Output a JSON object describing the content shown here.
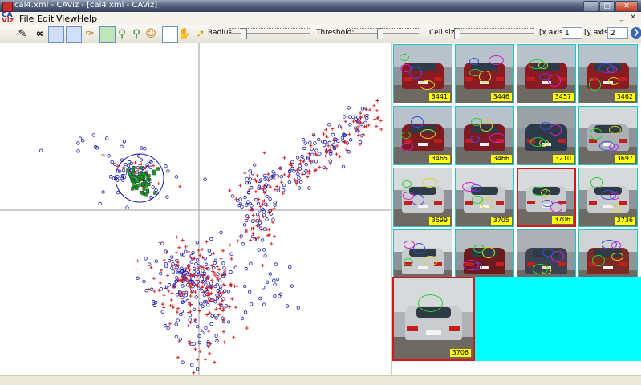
{
  "window": {
    "title": "cal4.xml - CAViz - [cal4.xml - CAViz]",
    "controls": [
      "minimize",
      "maximize",
      "close"
    ]
  },
  "menu": {
    "logo_top": "CA",
    "logo_bottom": "Viz",
    "items": [
      "File",
      "Edit",
      "View",
      "Help"
    ]
  },
  "toolbar": {
    "radius_label": "Radius:",
    "radius_level": 0.15,
    "threshold_label": "Threshold:",
    "threshold_level": 0.45,
    "cellsize_label": "Cell size:",
    "cellsize_level": 0.0,
    "xaxis_label": "[x axis]:",
    "xaxis_value": "1",
    "yaxis_label": "[y axis]:",
    "yaxis_value": "2",
    "icons": [
      "edit-icon",
      "glasses-icon",
      "select-w-icon",
      "select-b-icon",
      "lasso-icon",
      "comment-icon",
      "zoom-in-icon",
      "zoom-out-icon",
      "face-icon",
      "pointer-icon",
      "hand-icon",
      "pick-icon"
    ]
  },
  "scatter": {
    "series_colors": {
      "circle": "#1a1ab0",
      "plus": "#d81818",
      "selected": "#1f9a2a"
    }
  },
  "grid": {
    "labels": [
      "3441",
      "3446",
      "3457",
      "3462",
      "3465",
      "3466",
      "3210",
      "3697",
      "3699",
      "3705",
      "3706",
      "3736",
      "",
      "",
      "",
      ""
    ],
    "selected_index": 10,
    "border_color": "#19c7c7",
    "selected_border_color": "#d41818"
  },
  "result": {
    "label": "3706",
    "background": "#00ffff"
  }
}
